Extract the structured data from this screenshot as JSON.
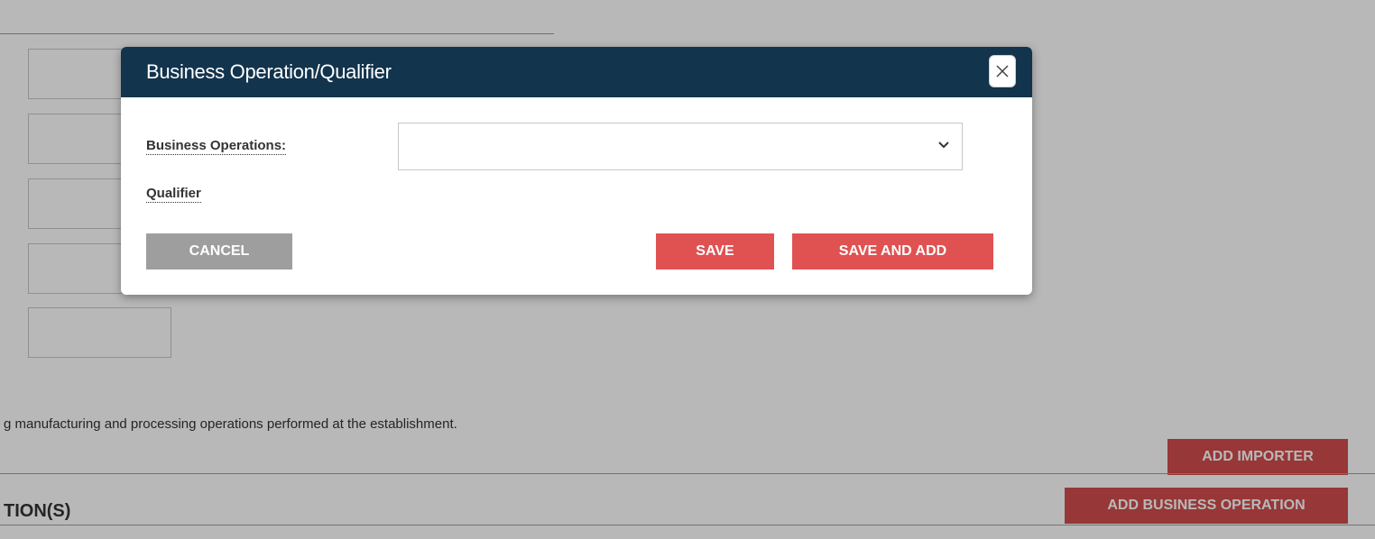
{
  "background": {
    "description_text": "g manufacturing and processing operations performed at the establishment.",
    "section_heading": "TION(S)",
    "add_importer_label": "ADD IMPORTER",
    "add_business_operation_label": "ADD BUSINESS OPERATION"
  },
  "modal": {
    "title": "Business Operation/Qualifier",
    "business_operations_label": "Business Operations:",
    "business_operations_value": "",
    "qualifier_label": "Qualifier",
    "cancel_label": "CANCEL",
    "save_label": "SAVE",
    "save_and_add_label": "SAVE AND ADD"
  },
  "icons": {
    "close": "close-icon",
    "dropdown": "chevron-down-icon"
  },
  "colors": {
    "header": "#12344d",
    "primary_button": "#e05252",
    "cancel_button": "#9e9e9e"
  }
}
